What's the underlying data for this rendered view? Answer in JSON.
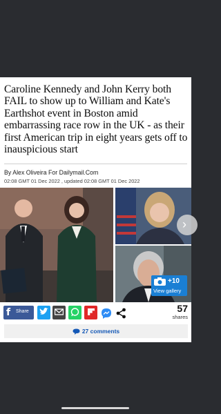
{
  "article": {
    "headline": "Caroline Kennedy and John Kerry both FAIL to show up to William and Kate's Earthshot event in Boston amid embarrassing race row in the UK - as their first American trip in eight years gets off to inauspicious start",
    "byline": "By Alex Oliveira For Dailymail.Com",
    "dates": "02:08 GMT 01 Dec 2022 , updated 02:08 GMT 01 Dec 2022"
  },
  "gallery": {
    "count": "+10",
    "label": "View gallery"
  },
  "share": {
    "facebook_label": "Share",
    "count": "57",
    "count_label": "shares"
  },
  "comments": {
    "label": "27 comments"
  },
  "colors": {
    "facebook": "#3b5998",
    "twitter": "#1da1f2",
    "whatsapp": "#25d366",
    "flipboard": "#e02828",
    "link": "#1458b6",
    "gallery": "#1a7fd4"
  }
}
